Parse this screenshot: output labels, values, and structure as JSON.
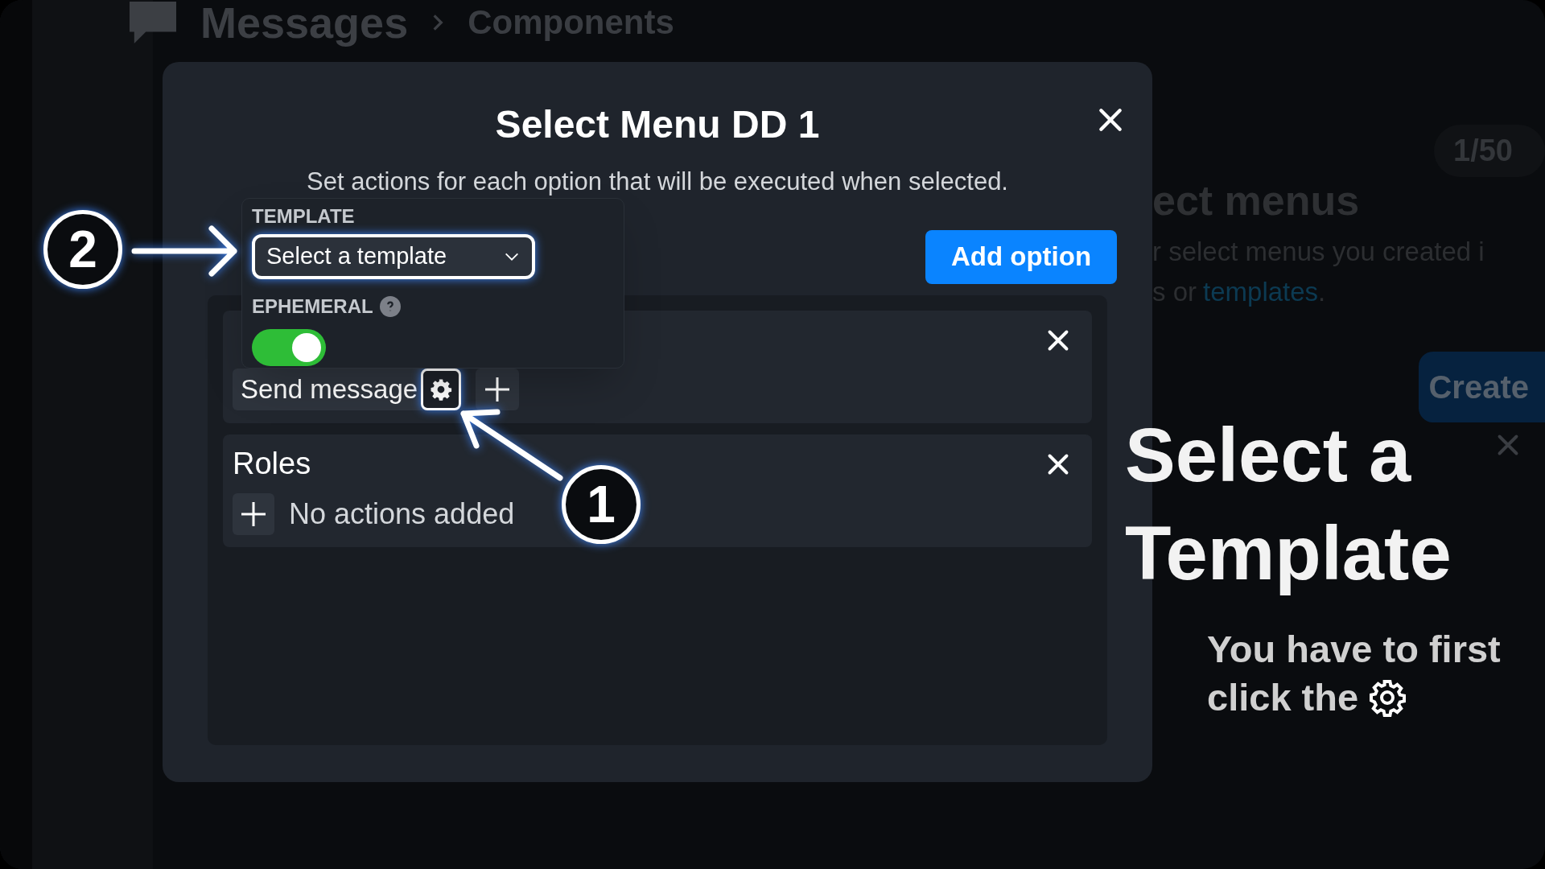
{
  "background": {
    "breadcrumb": [
      "Messages",
      "Components"
    ],
    "heading": "ect menus",
    "count": "1/50",
    "description": "r select menus you created i",
    "link_prefix": "s or",
    "link": "templates",
    "link_suffix": ".",
    "create_button": "Create"
  },
  "modal": {
    "title": "Select Menu DD 1",
    "subtitle": "Set actions for each option that will be executed when selected.",
    "add_button": "Add option",
    "options": [
      {
        "actions": [
          {
            "label": "Send message",
            "highlighted": true
          }
        ]
      },
      {
        "name": "Roles",
        "empty_text": "No actions added"
      }
    ]
  },
  "popover": {
    "template_label": "TEMPLATE",
    "template_placeholder": "Select a template",
    "ephemeral_label": "EPHEMERAL",
    "ephemeral_on": true
  },
  "callouts": [
    {
      "number": "2"
    },
    {
      "number": "1"
    }
  ],
  "tip": {
    "title": "Select a Template",
    "body_lines": [
      "You have to first",
      "click the"
    ]
  }
}
